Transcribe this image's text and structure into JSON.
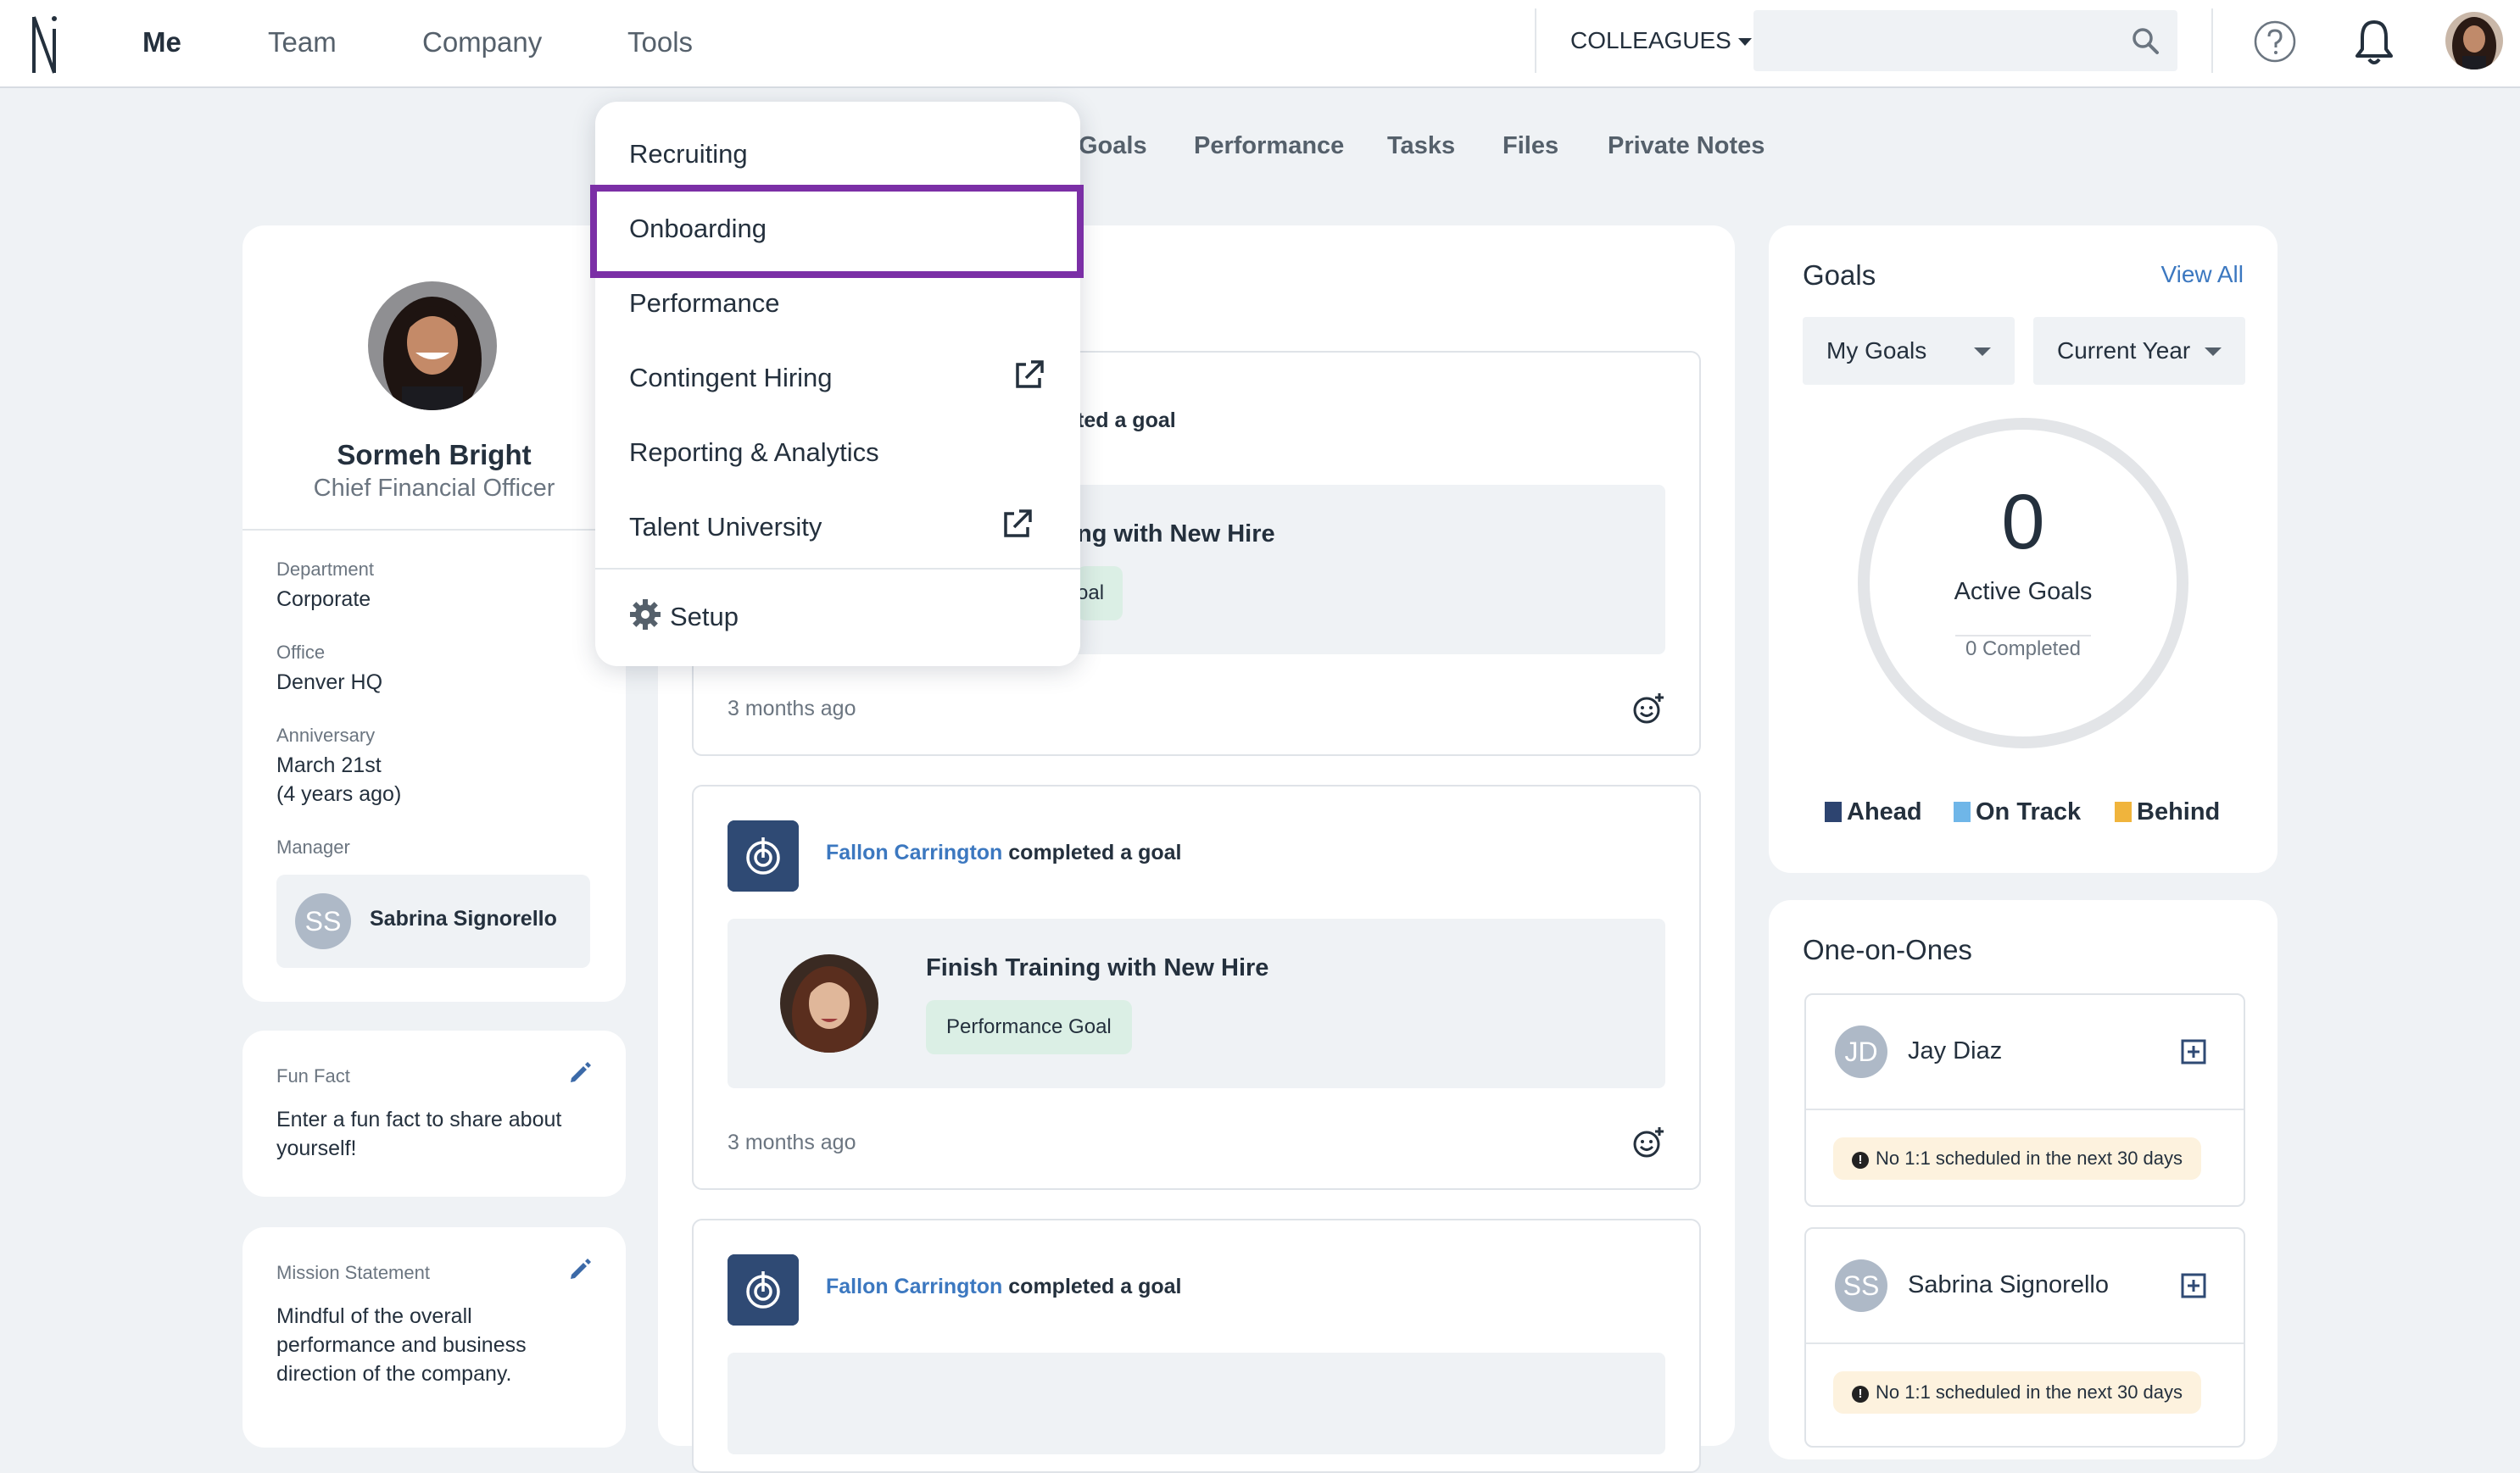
{
  "nav": {
    "items": [
      "Me",
      "Team",
      "Company",
      "Tools"
    ],
    "colleagues_label": "COLLEAGUES",
    "search_placeholder": ""
  },
  "subtabs": [
    "Goals",
    "Performance",
    "Tasks",
    "Files",
    "Private Notes"
  ],
  "tools_menu": {
    "items": [
      "Recruiting",
      "Onboarding",
      "Performance",
      "Contingent Hiring",
      "Reporting & Analytics",
      "Talent University"
    ],
    "setup_label": "Setup",
    "highlighted": "Onboarding",
    "highlight_color": "#7b2fa6"
  },
  "profile": {
    "name": "Sormeh Bright",
    "title": "Chief Financial Officer",
    "department_label": "Department",
    "department": "Corporate",
    "office_label": "Office",
    "office": "Denver HQ",
    "anniversary_label": "Anniversary",
    "anniversary": "March 21st",
    "anniversary_ago": "(4 years ago)",
    "manager_label": "Manager",
    "manager_initials": "SS",
    "manager_name": "Sabrina Signorello"
  },
  "fun_fact": {
    "label": "Fun Fact",
    "text": "Enter a fun fact to share about yourself!"
  },
  "mission": {
    "label": "Mission Statement",
    "lines": [
      "Mindful of the overall",
      "performance and business",
      "direction of the company."
    ]
  },
  "feed": {
    "item1": {
      "action_partial": "ted a goal",
      "title_partial": "ng with New Hire",
      "tag_partial": "oal",
      "time": "3 months ago"
    },
    "item2": {
      "who": "Fallon Carrington",
      "action": "completed a goal",
      "title": "Finish Training with New Hire",
      "tag": "Performance Goal",
      "time": "3 months ago"
    },
    "item3": {
      "who": "Fallon Carrington",
      "action": "completed a goal"
    }
  },
  "goals": {
    "title": "Goals",
    "view_all": "View All",
    "filter_owner": "My Goals",
    "filter_period": "Current Year",
    "active_count": "0",
    "active_label": "Active Goals",
    "completed_label": "0 Completed",
    "legend": [
      {
        "label": "Ahead",
        "color": "#2d4470"
      },
      {
        "label": "On Track",
        "color": "#6fb6e8"
      },
      {
        "label": "Behind",
        "color": "#f0b43c"
      }
    ]
  },
  "one_on_ones": {
    "title": "One-on-Ones",
    "people": [
      {
        "initials": "JD",
        "name": "Jay Diaz",
        "status": "No 1:1 scheduled in the next 30 days"
      },
      {
        "initials": "SS",
        "name": "Sabrina Signorello",
        "status": "No 1:1 scheduled in the next 30 days"
      }
    ]
  }
}
